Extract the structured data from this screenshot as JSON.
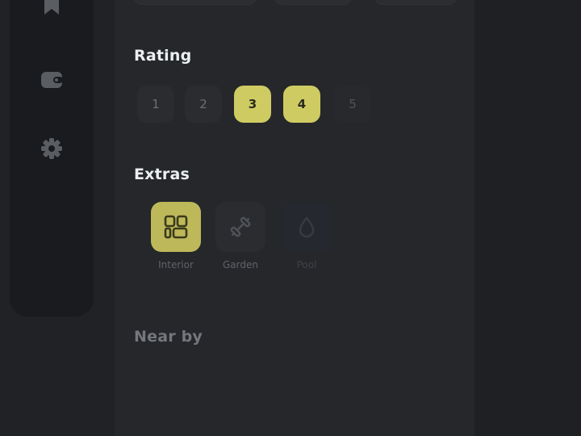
{
  "sidebar": {
    "icons": [
      {
        "name": "bookmark-icon"
      },
      {
        "name": "wallet-icon"
      },
      {
        "name": "settings-icon"
      }
    ]
  },
  "rating": {
    "title": "Rating",
    "options": [
      {
        "label": "1",
        "selected": false
      },
      {
        "label": "2",
        "selected": false
      },
      {
        "label": "3",
        "selected": true
      },
      {
        "label": "4",
        "selected": true
      },
      {
        "label": "5",
        "selected": false
      }
    ]
  },
  "extras": {
    "title": "Extras",
    "items": [
      {
        "label": "Interior",
        "icon": "layout-icon",
        "selected": true
      },
      {
        "label": "Garden",
        "icon": "dumbbell-icon",
        "selected": false
      },
      {
        "label": "Pool",
        "icon": "drop-icon",
        "selected": false
      }
    ]
  },
  "nearby": {
    "title": "Near by"
  },
  "colors": {
    "background": "#202226",
    "panel": "#25272b",
    "accent": "#cfcb63",
    "text": "#eceff1",
    "muted": "#6c6f74"
  }
}
